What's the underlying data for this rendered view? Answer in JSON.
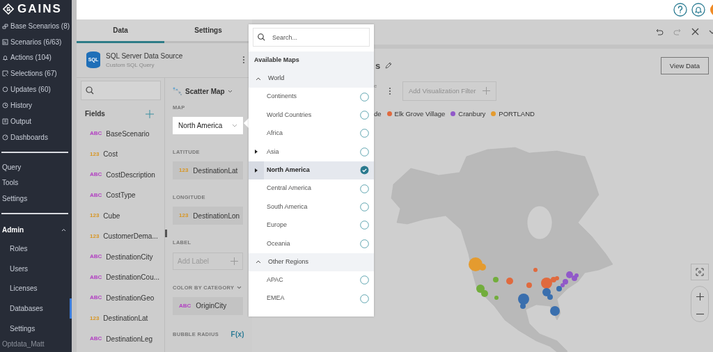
{
  "sidebar": {
    "logo": "GAINS",
    "items": [
      {
        "label": "Base Scenarios (8)"
      },
      {
        "label": "Scenarios (6/63)"
      },
      {
        "label": "Actions (104)"
      },
      {
        "label": "Selections (67)"
      },
      {
        "label": "Updates (60)"
      },
      {
        "label": "History"
      },
      {
        "label": "Output"
      },
      {
        "label": "Dashboards"
      }
    ],
    "tools": [
      {
        "label": "Query"
      },
      {
        "label": "Tools"
      },
      {
        "label": "Settings"
      }
    ],
    "admin": {
      "label": "Admin",
      "expanded": true,
      "children": [
        {
          "label": "Roles",
          "selected": false
        },
        {
          "label": "Users",
          "selected": false
        },
        {
          "label": "Licenses",
          "selected": false
        },
        {
          "label": "Databases",
          "selected": true
        },
        {
          "label": "Settings",
          "selected": false
        }
      ]
    },
    "user": "Optdata_Matt"
  },
  "editor": {
    "tabs": [
      {
        "label": "Data",
        "selected": true
      },
      {
        "label": "Settings",
        "selected": false
      }
    ],
    "data_source": {
      "title": "SQL Server Data Source",
      "subtitle": "Custom SQL Query",
      "icon_text": "SQL"
    },
    "fields": {
      "title": "Fields",
      "items": [
        {
          "type": "ABC",
          "name": "BaseScenario"
        },
        {
          "type": "123",
          "name": "Cost"
        },
        {
          "type": "ABC",
          "name": "CostDescription"
        },
        {
          "type": "ABC",
          "name": "CostType"
        },
        {
          "type": "123",
          "name": "Cube"
        },
        {
          "type": "123",
          "name": "CustomerDema..."
        },
        {
          "type": "ABC",
          "name": "DestinationCity"
        },
        {
          "type": "ABC",
          "name": "DestinationCou..."
        },
        {
          "type": "ABC",
          "name": "DestinationGeo"
        },
        {
          "type": "123",
          "name": "DestinationLat"
        },
        {
          "type": "ABC",
          "name": "DestinationLeg"
        }
      ]
    },
    "config": {
      "chart_type": "Scatter Map",
      "sections": [
        {
          "kind": "select",
          "label": "MAP",
          "value": "North America"
        },
        {
          "kind": "field",
          "label": "LATITUDE",
          "field": {
            "type": "123",
            "name": "DestinationLat"
          }
        },
        {
          "kind": "field",
          "label": "LONGITUDE",
          "field": {
            "type": "123",
            "name": "DestinationLon"
          }
        },
        {
          "kind": "empty",
          "label": "LABEL",
          "placeholder": "Add Label"
        },
        {
          "kind": "field",
          "label": "COLOR BY CATEGORY",
          "dropdown": true,
          "field": {
            "type": "ABC",
            "name": "OriginCity"
          }
        },
        {
          "kind": "formula",
          "label": "BUBBLE RADIUS",
          "action": "F(x)"
        }
      ]
    }
  },
  "map_picker": {
    "search_placeholder": "Search...",
    "heading": "Available Maps",
    "groups": [
      {
        "label": "World",
        "expanded": true,
        "items": [
          {
            "label": "Continents",
            "selected": false,
            "has_children": false
          },
          {
            "label": "World Countries",
            "selected": false,
            "has_children": false
          },
          {
            "label": "Africa",
            "selected": false,
            "has_children": false
          },
          {
            "label": "Asia",
            "selected": false,
            "has_children": true
          },
          {
            "label": "North America",
            "selected": true,
            "has_children": true
          },
          {
            "label": "Central America",
            "selected": false,
            "has_children": false
          },
          {
            "label": "South America",
            "selected": false,
            "has_children": false
          },
          {
            "label": "Europe",
            "selected": false,
            "has_children": false
          },
          {
            "label": "Oceania",
            "selected": false,
            "has_children": false
          }
        ]
      },
      {
        "label": "Other Regions",
        "expanded": true,
        "items": [
          {
            "label": "APAC",
            "selected": false,
            "has_children": false
          },
          {
            "label": "EMEA",
            "selected": false,
            "has_children": false
          }
        ]
      }
    ]
  },
  "canvas": {
    "title": "s",
    "subtitle": "e",
    "view_data": "View Data",
    "filter_placeholder": "Add Visualization Filter",
    "legend": [
      {
        "label": "de"
      },
      {
        "label": "Elk Grove Village",
        "color": "#e06a3e"
      },
      {
        "label": "Cranbury",
        "color": "#9159c9"
      },
      {
        "label": "PORTLAND",
        "color": "#e49b2f"
      }
    ]
  }
}
